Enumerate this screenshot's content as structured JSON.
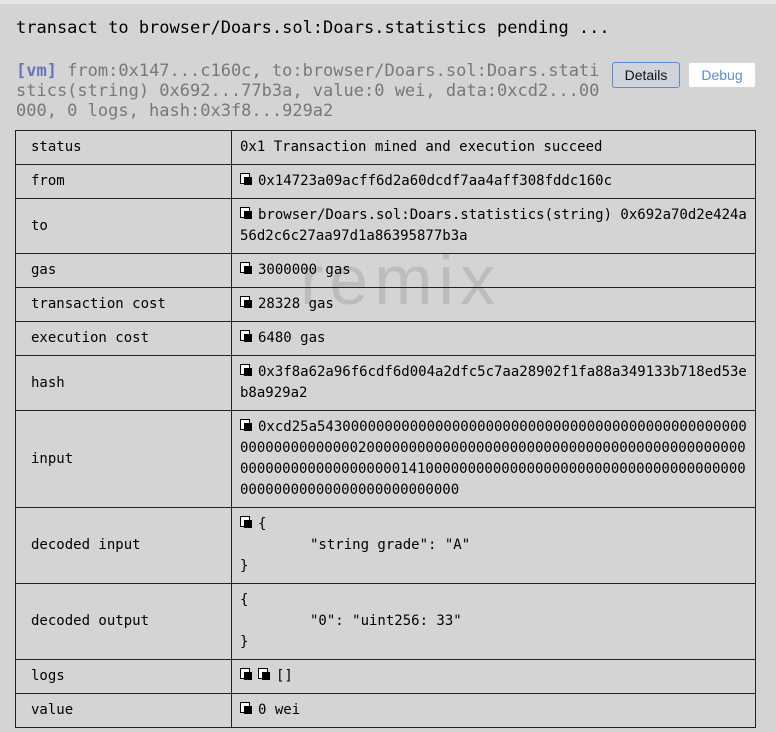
{
  "header": {
    "title": "transact to browser/Doars.sol:Doars.statistics pending ...",
    "tag": "[vm]",
    "summary": " from:0x147...c160c, to:browser/Doars.sol:Doars.statistics(string) 0x692...77b3a, value:0 wei, data:0xcd2...00000, 0 logs, hash:0x3f8...929a2",
    "details_label": "Details",
    "debug_label": "Debug"
  },
  "watermark": "remix",
  "rows": {
    "status": {
      "key": "status",
      "value": "0x1 Transaction mined and execution succeed"
    },
    "from": {
      "key": "from",
      "value": "0x14723a09acff6d2a60dcdf7aa4aff308fddc160c"
    },
    "to": {
      "key": "to",
      "value": "browser/Doars.sol:Doars.statistics(string) 0x692a70d2e424a56d2c6c27aa97d1a86395877b3a"
    },
    "gas": {
      "key": "gas",
      "value": "3000000 gas"
    },
    "transaction_cost": {
      "key": "transaction cost",
      "value": "28328 gas"
    },
    "execution_cost": {
      "key": "execution cost",
      "value": "6480 gas"
    },
    "hash": {
      "key": "hash",
      "value": "0x3f8a62a96f6cdf6d004a2dfc5c7aa28902f1fa88a349133b718ed53eb8a929a2"
    },
    "input": {
      "key": "input",
      "value": "0xcd25a54300000000000000000000000000000000000000000000000000000000000000200000000000000000000000000000000000000000000000000000000000000001410000000000000000000000000000000000000000000000000000000000000000"
    },
    "decoded_input": {
      "key": "decoded input",
      "open": "{",
      "entry": "\"string grade\": \"A\"",
      "close": "}"
    },
    "decoded_output": {
      "key": "decoded output",
      "open": "{",
      "entry": "\"0\": \"uint256: 33\"",
      "close": "}"
    },
    "logs": {
      "key": "logs",
      "value": "[]"
    },
    "value": {
      "key": "value",
      "value": "0 wei"
    }
  },
  "icons": {
    "copy": "copy-icon"
  }
}
